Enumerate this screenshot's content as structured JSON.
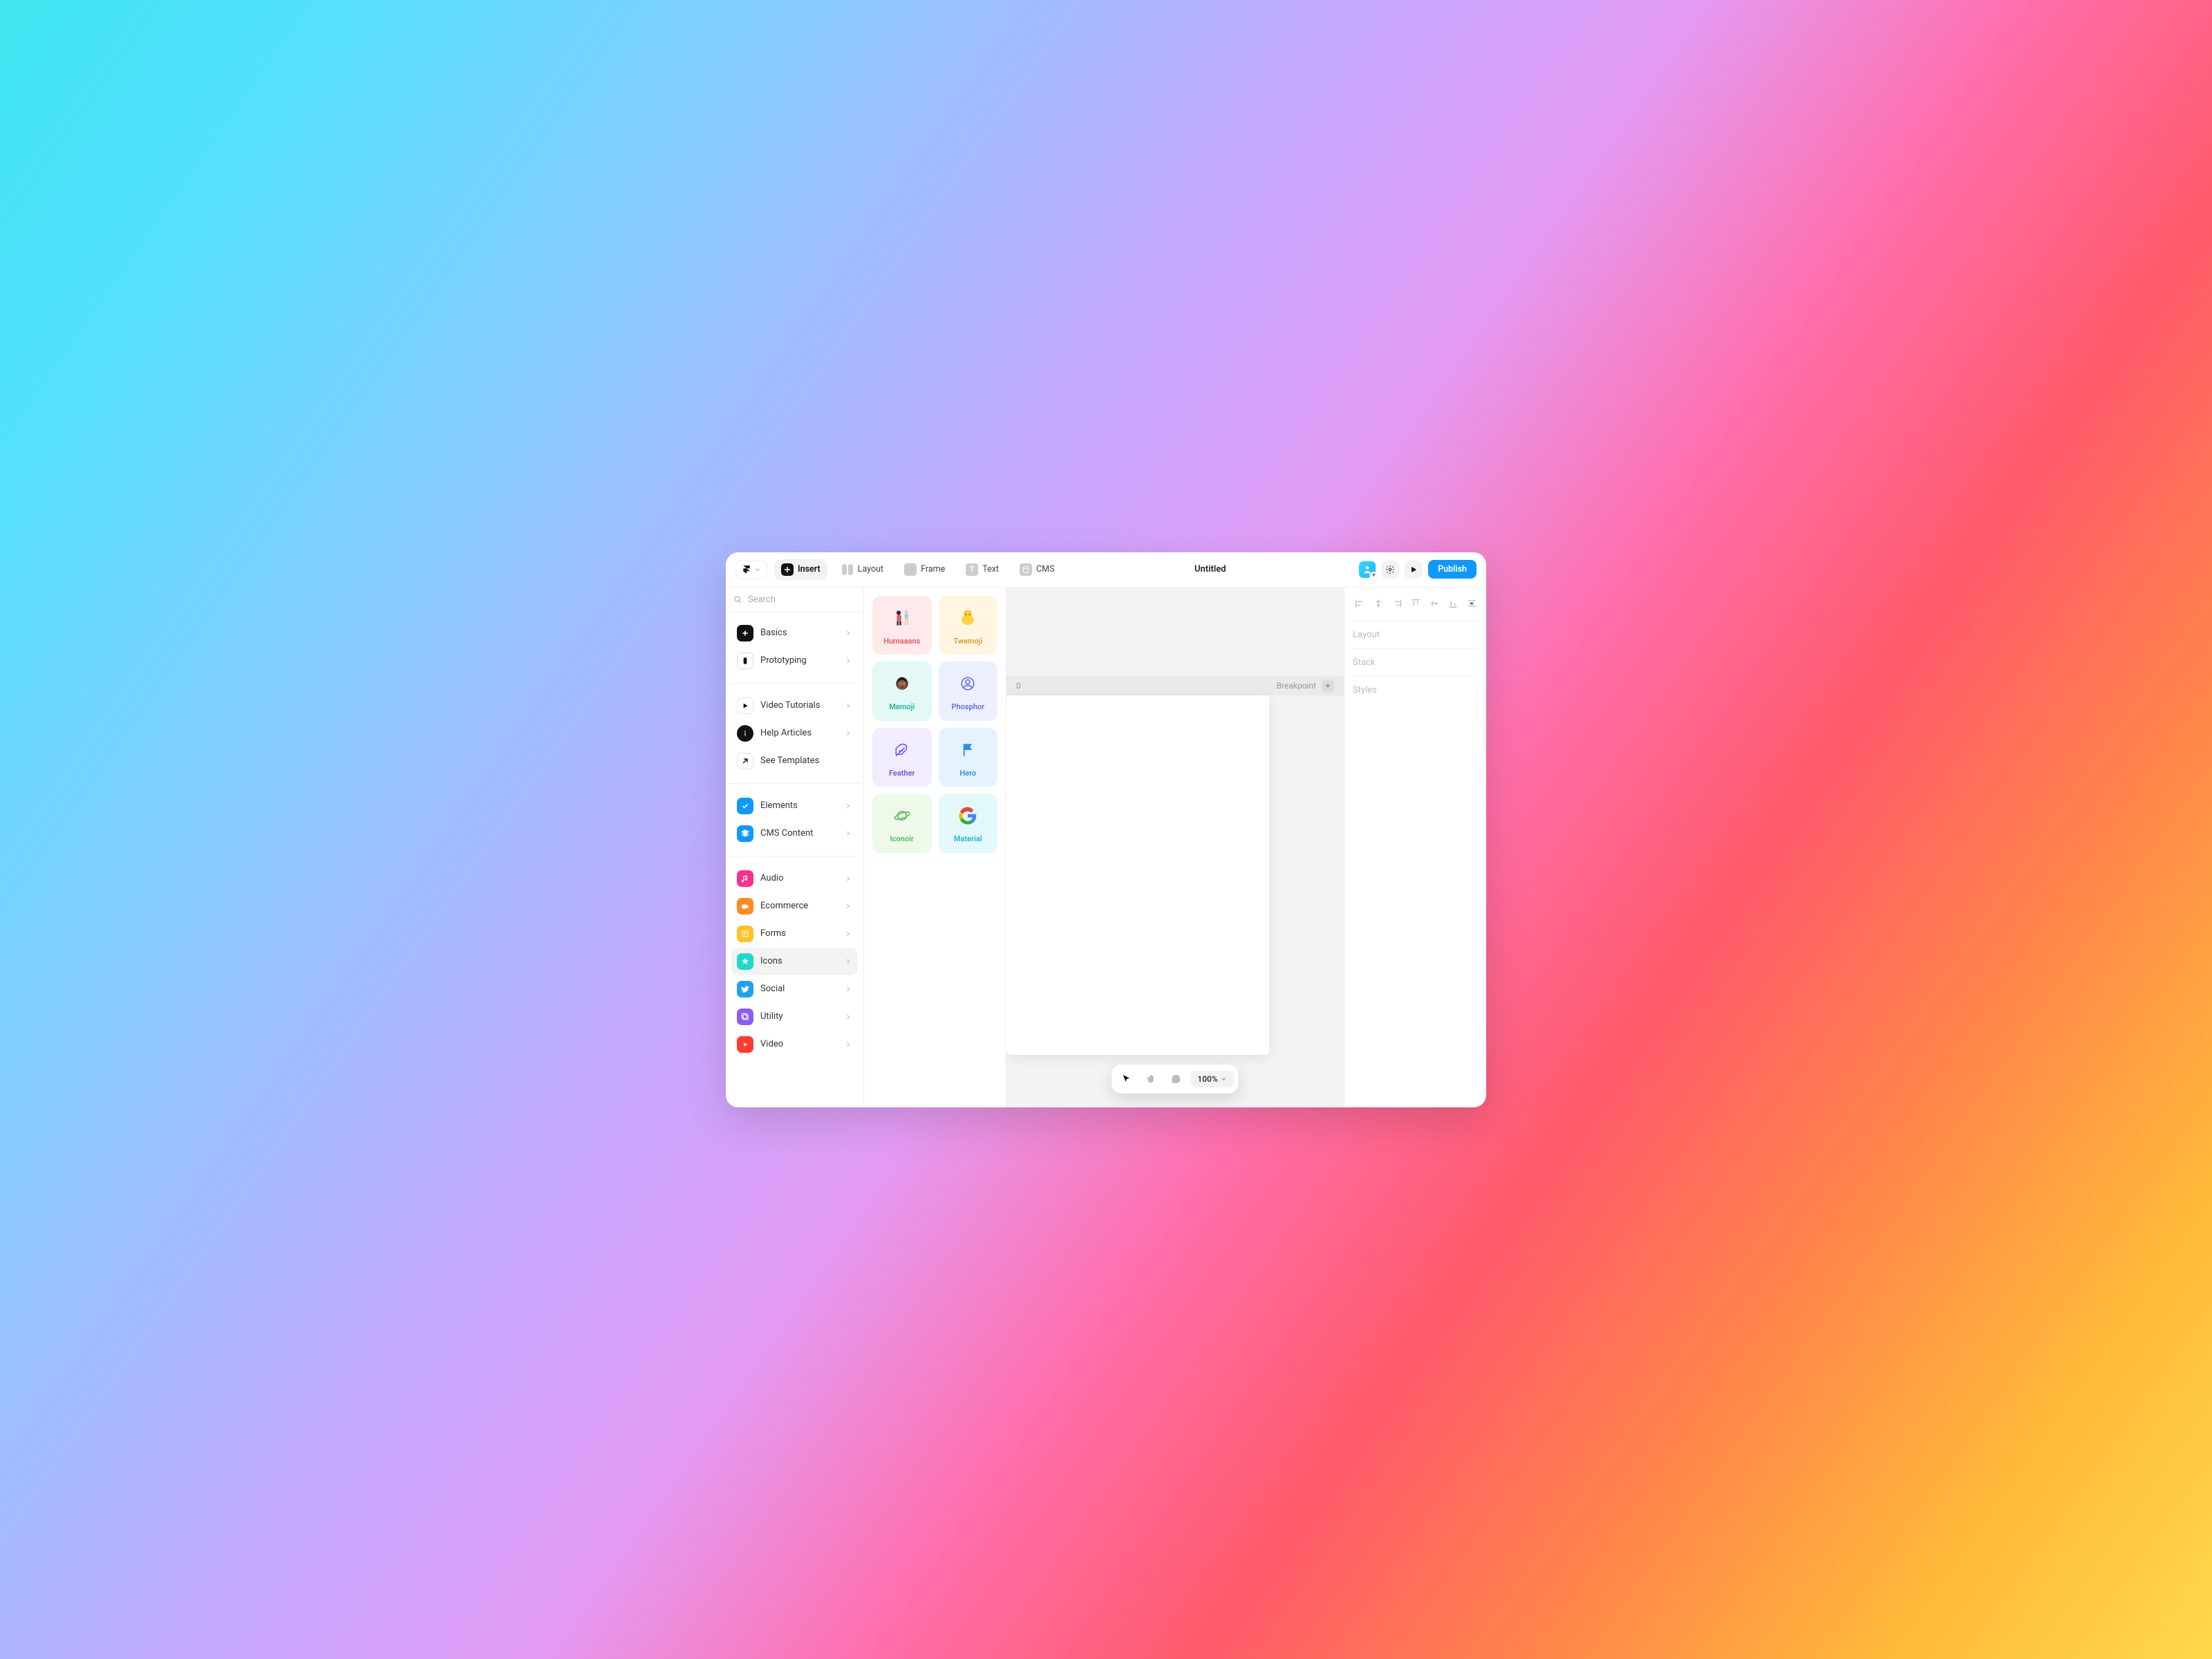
{
  "topbar": {
    "insert": "Insert",
    "layout": "Layout",
    "frame": "Frame",
    "text": "Text",
    "cms": "CMS",
    "publish": "Publish"
  },
  "document": {
    "title": "Untitled"
  },
  "search": {
    "placeholder": "Search"
  },
  "sidebar": {
    "core": [
      {
        "label": "Basics"
      },
      {
        "label": "Prototyping"
      }
    ],
    "learn": [
      {
        "label": "Video Tutorials"
      },
      {
        "label": "Help Articles"
      },
      {
        "label": "See Templates"
      }
    ],
    "libraries": [
      {
        "label": "Elements"
      },
      {
        "label": "CMS Content"
      }
    ],
    "categories": [
      {
        "label": "Audio"
      },
      {
        "label": "Ecommerce"
      },
      {
        "label": "Forms"
      },
      {
        "label": "Icons"
      },
      {
        "label": "Social"
      },
      {
        "label": "Utility"
      },
      {
        "label": "Video"
      }
    ]
  },
  "iconPacks": [
    {
      "label": "Humaaans"
    },
    {
      "label": "Twemoji"
    },
    {
      "label": "Memoji"
    },
    {
      "label": "Phosphor"
    },
    {
      "label": "Feather"
    },
    {
      "label": "Hero"
    },
    {
      "label": "Iconoir"
    },
    {
      "label": "Material"
    }
  ],
  "canvas": {
    "breakpoint_origin": "0",
    "breakpoint_label": "Breakpoint",
    "zoom": "100%"
  },
  "inspector": {
    "layout": "Layout",
    "stack": "Stack",
    "styles": "Styles"
  }
}
